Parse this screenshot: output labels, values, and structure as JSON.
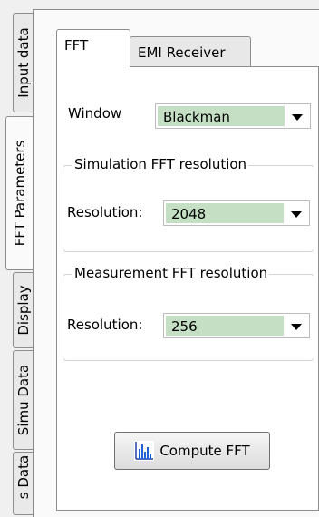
{
  "side_tabs": [
    {
      "label": "Input data",
      "active": false
    },
    {
      "label": "FFT Parameters",
      "active": true
    },
    {
      "label": "Display",
      "active": false
    },
    {
      "label": "Simu Data",
      "active": false
    },
    {
      "label": "s Data",
      "active": false
    }
  ],
  "tabs": [
    {
      "label": "FFT",
      "active": true
    },
    {
      "label": "EMI Receiver",
      "active": false
    }
  ],
  "window": {
    "label": "Window",
    "value": "Blackman"
  },
  "simulation_group": {
    "title": "Simulation FFT resolution",
    "label": "Resolution:",
    "value": "2048"
  },
  "measurement_group": {
    "title": "Measurement FFT resolution",
    "label": "Resolution:",
    "value": "256"
  },
  "compute_button": {
    "label": "Compute FFT",
    "icon": "bar-chart-icon"
  },
  "colors": {
    "combo_fill": "#c4dfc4",
    "panel": "#fafafa",
    "chrome": "#f0f0f0"
  }
}
